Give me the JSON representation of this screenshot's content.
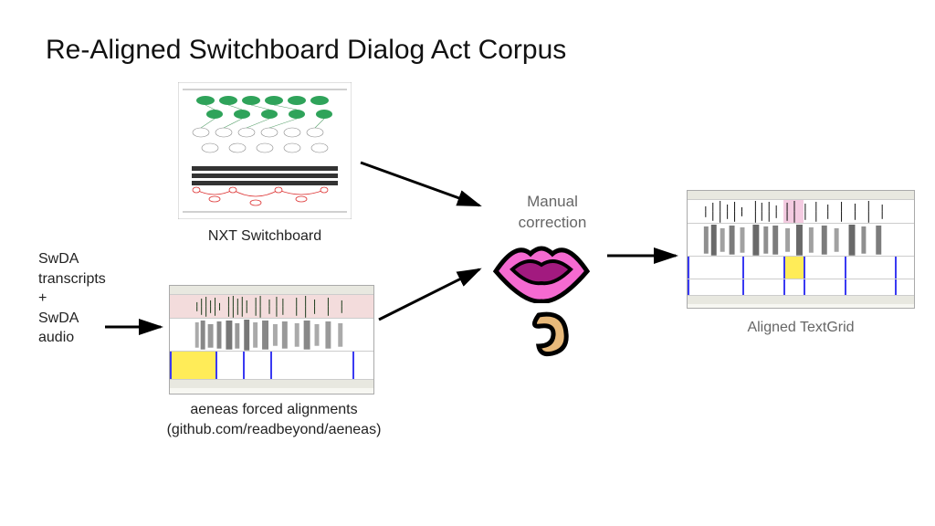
{
  "title": "Re-Aligned Switchboard Dialog Act Corpus",
  "labels": {
    "swda": "SwDA\ntranscripts\n+\nSwDA\naudio",
    "nxt": "NXT Switchboard",
    "aeneas_line1": "aeneas forced alignments",
    "aeneas_line2": "(github.com/readbeyond/aeneas)",
    "manual": "Manual\ncorrection",
    "aligned": "Aligned TextGrid"
  },
  "icons": {
    "lips": "lips-icon",
    "ear": "ear-icon"
  }
}
